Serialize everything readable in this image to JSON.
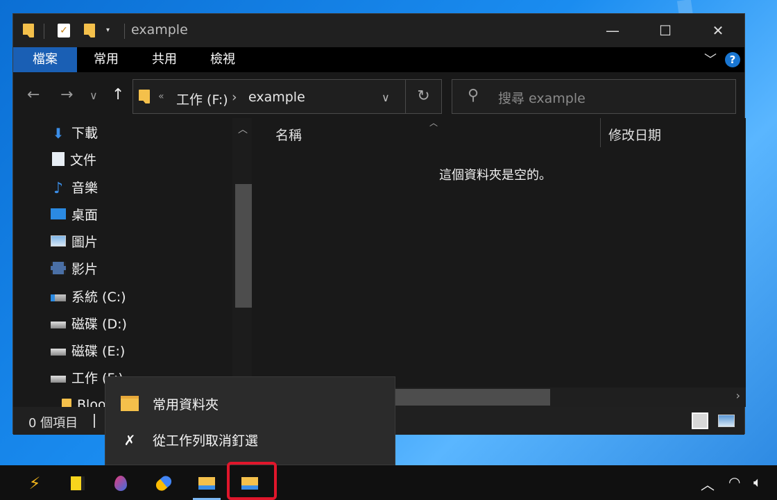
{
  "window": {
    "title": "example",
    "buttons": {
      "minimize": "—",
      "maximize": "☐",
      "close": "✕"
    }
  },
  "ribbon": {
    "tabs": [
      "檔案",
      "常用",
      "共用",
      "檢視"
    ],
    "help": "?"
  },
  "address": {
    "crumb_sep": "«",
    "drive": "工作 (F:)",
    "arrow": "›",
    "folder": "example"
  },
  "search": {
    "placeholder": "搜尋 example"
  },
  "nav_pane": {
    "items": [
      {
        "label": "下載",
        "icon": "download-icon"
      },
      {
        "label": "文件",
        "icon": "document-icon"
      },
      {
        "label": "音樂",
        "icon": "music-icon"
      },
      {
        "label": "桌面",
        "icon": "desktop-icon"
      },
      {
        "label": "圖片",
        "icon": "pictures-icon"
      },
      {
        "label": "影片",
        "icon": "video-icon"
      },
      {
        "label": "系統 (C:)",
        "icon": "system-drive-icon"
      },
      {
        "label": "磁碟 (D:)",
        "icon": "drive-icon"
      },
      {
        "label": "磁碟 (E:)",
        "icon": "drive-icon"
      },
      {
        "label": "工作 (F:)",
        "icon": "drive-icon"
      },
      {
        "label": "Bloo",
        "icon": "folder-icon"
      }
    ]
  },
  "content": {
    "columns": [
      "名稱",
      "修改日期"
    ],
    "empty_message": "這個資料夾是空的。"
  },
  "status": {
    "item_count": "0 個項目"
  },
  "context_menu": {
    "items": [
      {
        "label": "常用資料夾",
        "icon": "folder-icon"
      },
      {
        "label": "從工作列取消釘選",
        "icon": "unpin-icon"
      }
    ]
  },
  "colors": {
    "accent": "#1a5fb4",
    "highlight": "#e0162b",
    "folder": "#f4c04b"
  }
}
